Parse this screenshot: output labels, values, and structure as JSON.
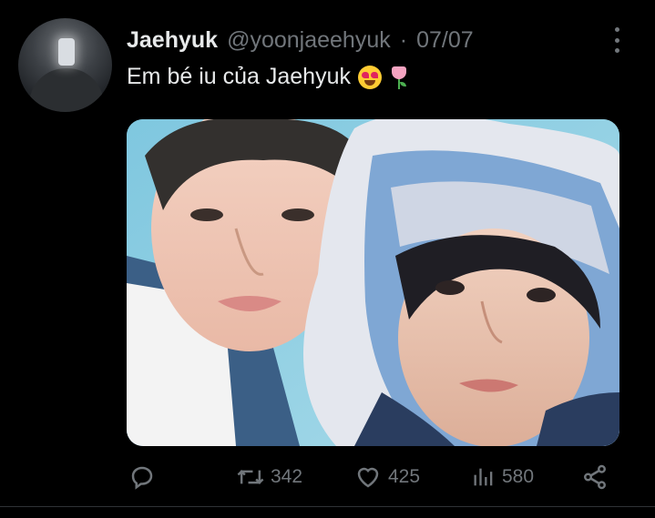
{
  "tweet": {
    "display_name": "Jaehyuk",
    "handle": "@yoonjaeehyuk",
    "separator": "·",
    "date": "07/07",
    "text": "Em bé iu của Jaehyuk",
    "emojis": [
      "smiling-face-with-heart-eyes",
      "tulip"
    ]
  },
  "actions": {
    "reply": {
      "icon": "reply-icon",
      "count": ""
    },
    "retweet": {
      "icon": "retweet-icon",
      "count": "342"
    },
    "like": {
      "icon": "heart-icon",
      "count": "425"
    },
    "views": {
      "icon": "views-icon",
      "count": "580"
    },
    "share": {
      "icon": "share-icon",
      "count": ""
    }
  },
  "colors": {
    "background": "#000000",
    "text": "#e7e9ea",
    "secondary_text": "#71767b",
    "divider": "#2f3336"
  }
}
